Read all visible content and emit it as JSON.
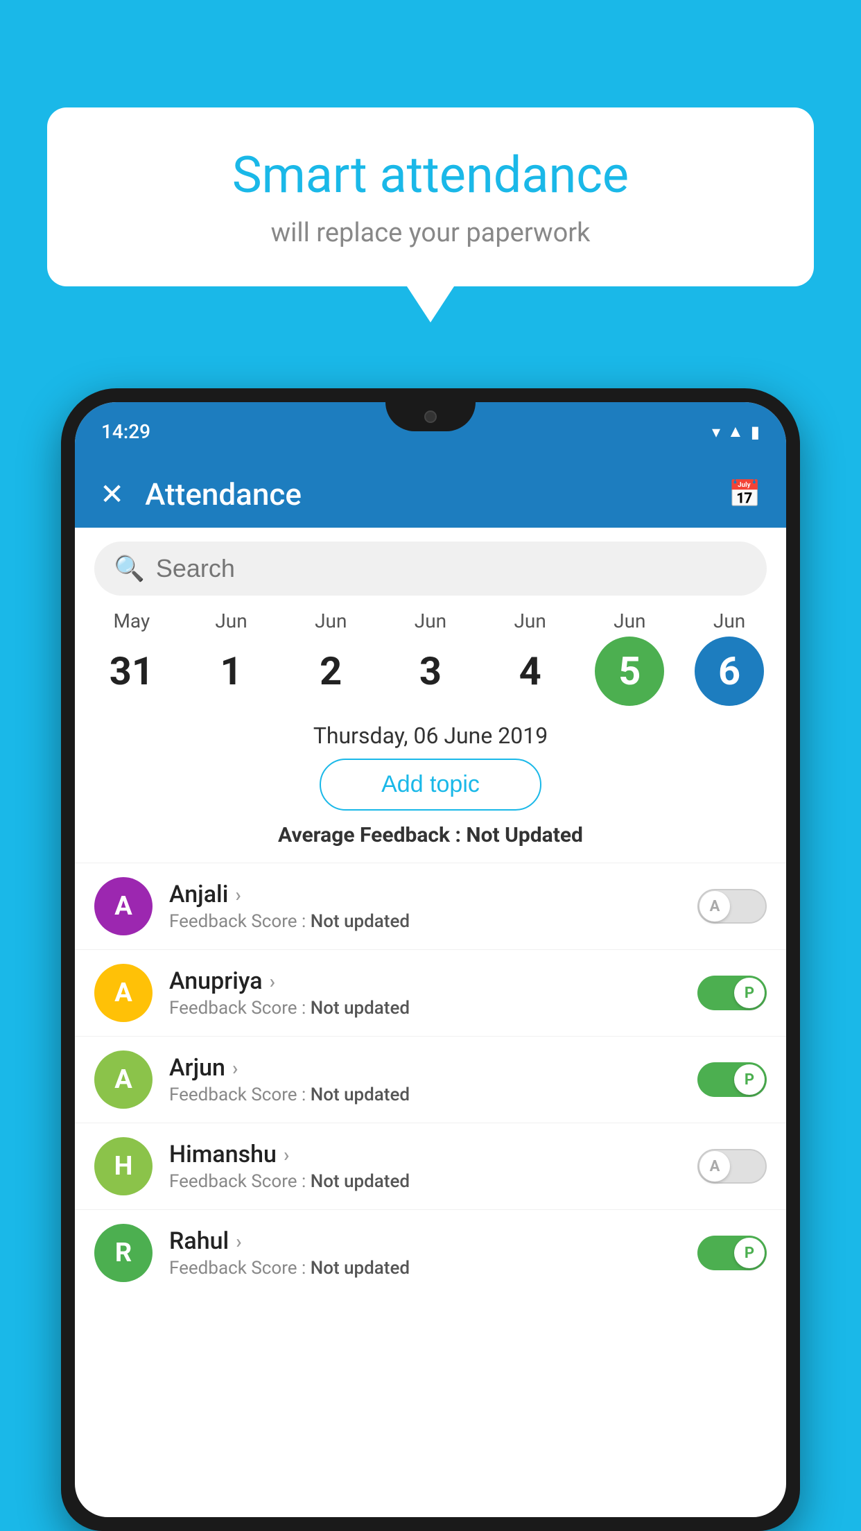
{
  "background_color": "#1ab8e8",
  "speech_bubble": {
    "title": "Smart attendance",
    "subtitle": "will replace your paperwork"
  },
  "status_bar": {
    "time": "14:29",
    "icons": [
      "wifi",
      "signal",
      "battery"
    ]
  },
  "app_bar": {
    "title": "Attendance",
    "close_label": "×",
    "calendar_icon": "📅"
  },
  "search": {
    "placeholder": "Search"
  },
  "calendar": {
    "days": [
      {
        "month": "May",
        "date": "31",
        "state": "normal"
      },
      {
        "month": "Jun",
        "date": "1",
        "state": "normal"
      },
      {
        "month": "Jun",
        "date": "2",
        "state": "normal"
      },
      {
        "month": "Jun",
        "date": "3",
        "state": "normal"
      },
      {
        "month": "Jun",
        "date": "4",
        "state": "normal"
      },
      {
        "month": "Jun",
        "date": "5",
        "state": "today"
      },
      {
        "month": "Jun",
        "date": "6",
        "state": "selected"
      }
    ]
  },
  "selected_date": "Thursday, 06 June 2019",
  "add_topic_label": "Add topic",
  "average_feedback": {
    "label": "Average Feedback : ",
    "value": "Not Updated"
  },
  "students": [
    {
      "name": "Anjali",
      "avatar_letter": "A",
      "avatar_color": "#9c27b0",
      "score_label": "Feedback Score : ",
      "score_value": "Not updated",
      "toggle": "off",
      "toggle_letter": "A"
    },
    {
      "name": "Anupriya",
      "avatar_letter": "A",
      "avatar_color": "#ffc107",
      "score_label": "Feedback Score : ",
      "score_value": "Not updated",
      "toggle": "on",
      "toggle_letter": "P"
    },
    {
      "name": "Arjun",
      "avatar_letter": "A",
      "avatar_color": "#8bc34a",
      "score_label": "Feedback Score : ",
      "score_value": "Not updated",
      "toggle": "on",
      "toggle_letter": "P"
    },
    {
      "name": "Himanshu",
      "avatar_letter": "H",
      "avatar_color": "#8bc34a",
      "score_label": "Feedback Score : ",
      "score_value": "Not updated",
      "toggle": "off",
      "toggle_letter": "A"
    },
    {
      "name": "Rahul",
      "avatar_letter": "R",
      "avatar_color": "#4caf50",
      "score_label": "Feedback Score : ",
      "score_value": "Not updated",
      "toggle": "on",
      "toggle_letter": "P"
    }
  ]
}
